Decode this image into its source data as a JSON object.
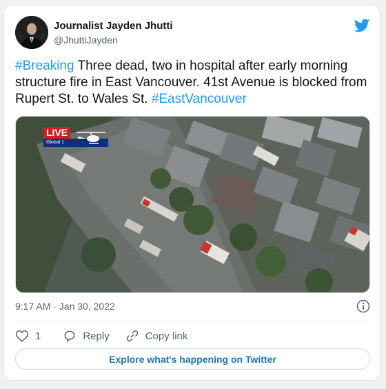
{
  "author": {
    "name": "Journalist Jayden Jhutti",
    "handle": "@JhuttiJayden"
  },
  "tweet": {
    "hashtag_1": "#Breaking",
    "body": " Three dead, two in hospital after early morning structure fire in East Vancouver. 41st Avenue is blocked from Rupert St. to Wales St. ",
    "hashtag_2": "#EastVancouver"
  },
  "media": {
    "broadcast_badge": "LIVE",
    "broadcast_channel": "Global 1",
    "icon": "helicopter-icon"
  },
  "meta": {
    "timestamp": "9:17 AM · Jan 30, 2022"
  },
  "actions": {
    "like_count": "1",
    "reply_label": "Reply",
    "copy_link_label": "Copy link"
  },
  "footer": {
    "explore_label": "Explore what's happening on Twitter"
  },
  "colors": {
    "brand": "#1d9bf0",
    "text": "#0f1419",
    "secondary": "#536471"
  }
}
